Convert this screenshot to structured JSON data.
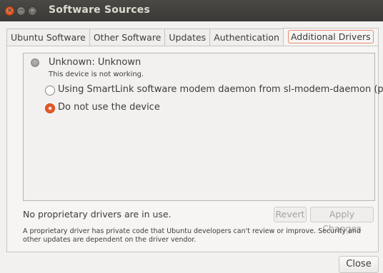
{
  "window": {
    "title": "Software Sources"
  },
  "tabs": [
    {
      "label": "Ubuntu Software"
    },
    {
      "label": "Other Software"
    },
    {
      "label": "Updates"
    },
    {
      "label": "Authentication"
    },
    {
      "label": "Additional Drivers",
      "active": true
    }
  ],
  "device": {
    "name": "Unknown: Unknown",
    "status": "This device is not working.",
    "options": [
      {
        "label": "Using SmartLink software modem daemon from sl-modem-daemon (proprietary)",
        "selected": false
      },
      {
        "label": "Do not use the device",
        "selected": true
      }
    ]
  },
  "footer": {
    "status": "No proprietary drivers are in use.",
    "revert_label": "Revert",
    "apply_label": "Apply Changes",
    "note": "A proprietary driver has private code that Ubuntu developers can't review or improve. Security and other updates are dependent on the driver vendor."
  },
  "close_label": "Close",
  "colors": {
    "accent": "#e9582a",
    "titlebar": "#3c3b37"
  }
}
